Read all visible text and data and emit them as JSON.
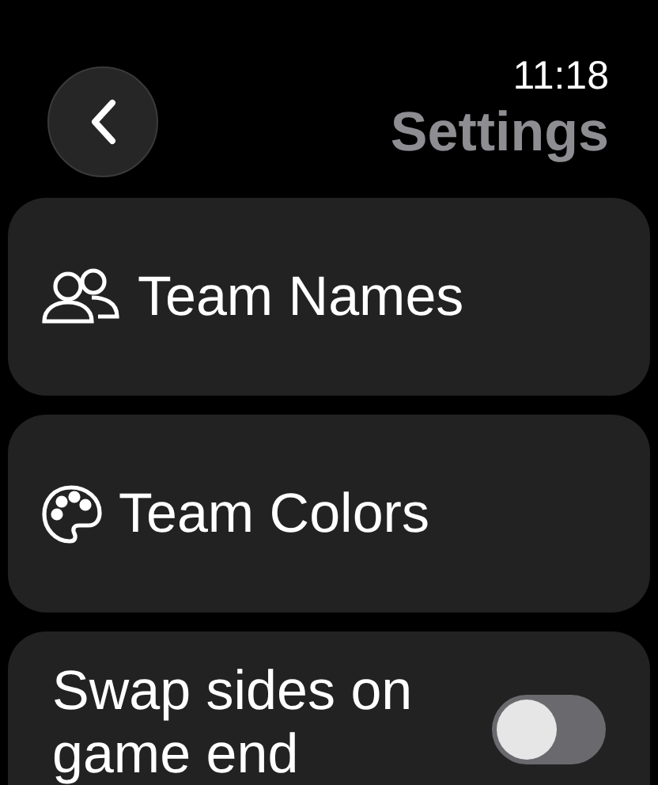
{
  "header": {
    "time": "11:18",
    "title": "Settings"
  },
  "items": [
    {
      "kind": "link",
      "label": "Team Names"
    },
    {
      "kind": "link",
      "label": "Team Colors"
    },
    {
      "kind": "toggle",
      "label": "Swap sides on game end",
      "on": false
    }
  ]
}
